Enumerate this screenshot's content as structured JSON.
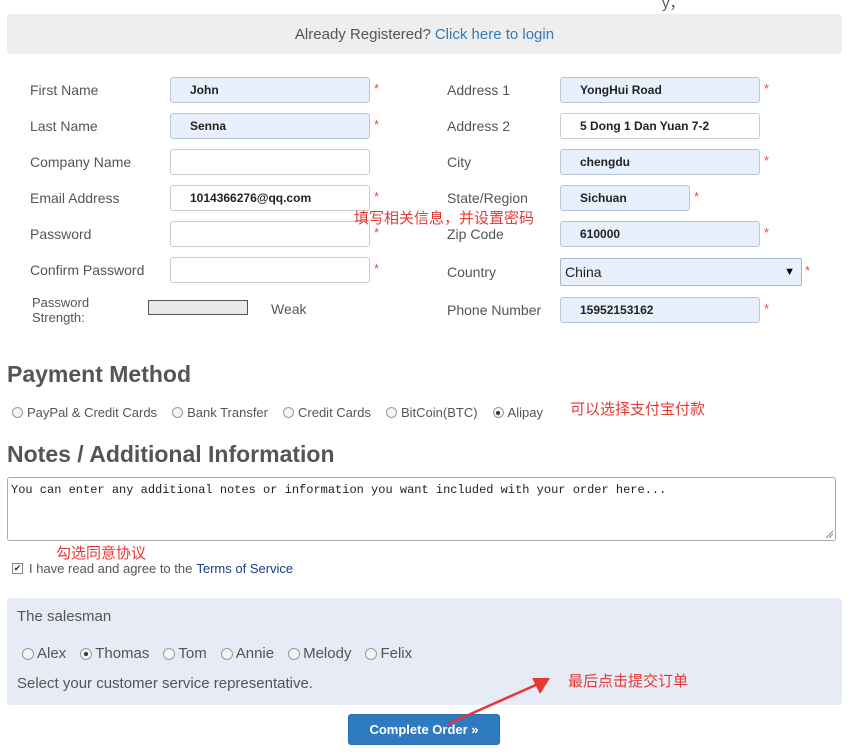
{
  "top_fragment": "y，",
  "already_registered": {
    "text": "Already Registered?",
    "link": "Click here to login"
  },
  "form": {
    "first_name": {
      "label": "First Name",
      "value": "John",
      "required": "*"
    },
    "last_name": {
      "label": "Last Name",
      "value": "Senna",
      "required": "*"
    },
    "company_name": {
      "label": "Company Name",
      "value": ""
    },
    "email": {
      "label": "Email Address",
      "value": "1014366276@qq.com",
      "required": "*"
    },
    "password": {
      "label": "Password",
      "value": "",
      "required": "*"
    },
    "confirm_password": {
      "label": "Confirm Password",
      "value": "",
      "required": "*"
    },
    "password_strength": {
      "label_line1": "Password",
      "label_line2": "Strength:",
      "value": "Weak"
    },
    "address1": {
      "label": "Address 1",
      "value": "YongHui Road",
      "required": "*"
    },
    "address2": {
      "label": "Address 2",
      "value": "5 Dong 1 Dan Yuan 7-2"
    },
    "city": {
      "label": "City",
      "value": "chengdu",
      "required": "*"
    },
    "state": {
      "label": "State/Region",
      "value": "Sichuan",
      "required": "*"
    },
    "zip": {
      "label": "Zip Code",
      "value": "610000",
      "required": "*"
    },
    "country": {
      "label": "Country",
      "value": "China",
      "required": "*"
    },
    "phone": {
      "label": "Phone Number",
      "value": "15952153162",
      "required": "*"
    }
  },
  "payment": {
    "heading": "Payment Method",
    "options": [
      "PayPal & Credit Cards",
      "Bank Transfer",
      "Credit Cards",
      "BitCoin(BTC)",
      "Alipay"
    ],
    "selected": "Alipay"
  },
  "notes": {
    "heading": "Notes / Additional Information",
    "placeholder": "You can enter any additional notes or information you want included with your order here..."
  },
  "agreement": {
    "text": "I have read and agree to the",
    "link": "Terms of Service",
    "checked": true
  },
  "salesman": {
    "title": "The salesman",
    "options": [
      "Alex",
      "Thomas",
      "Tom",
      "Annie",
      "Melody",
      "Felix"
    ],
    "selected": "Thomas",
    "hint": "Select your customer service representative."
  },
  "complete_button": "Complete Order »",
  "annotations": {
    "fill_info": "填写相关信息，并设置密码",
    "alipay": "可以选择支付宝付款",
    "agree": "勾选同意协议",
    "submit": "最后点击提交订单"
  },
  "colors": {
    "required": "#d9534f",
    "link": "#337ab7",
    "annotation": "#e53935",
    "button": "#2e7bc1",
    "salesman_bg": "#e6ebf5",
    "autofill_bg": "#e8f0fe"
  }
}
